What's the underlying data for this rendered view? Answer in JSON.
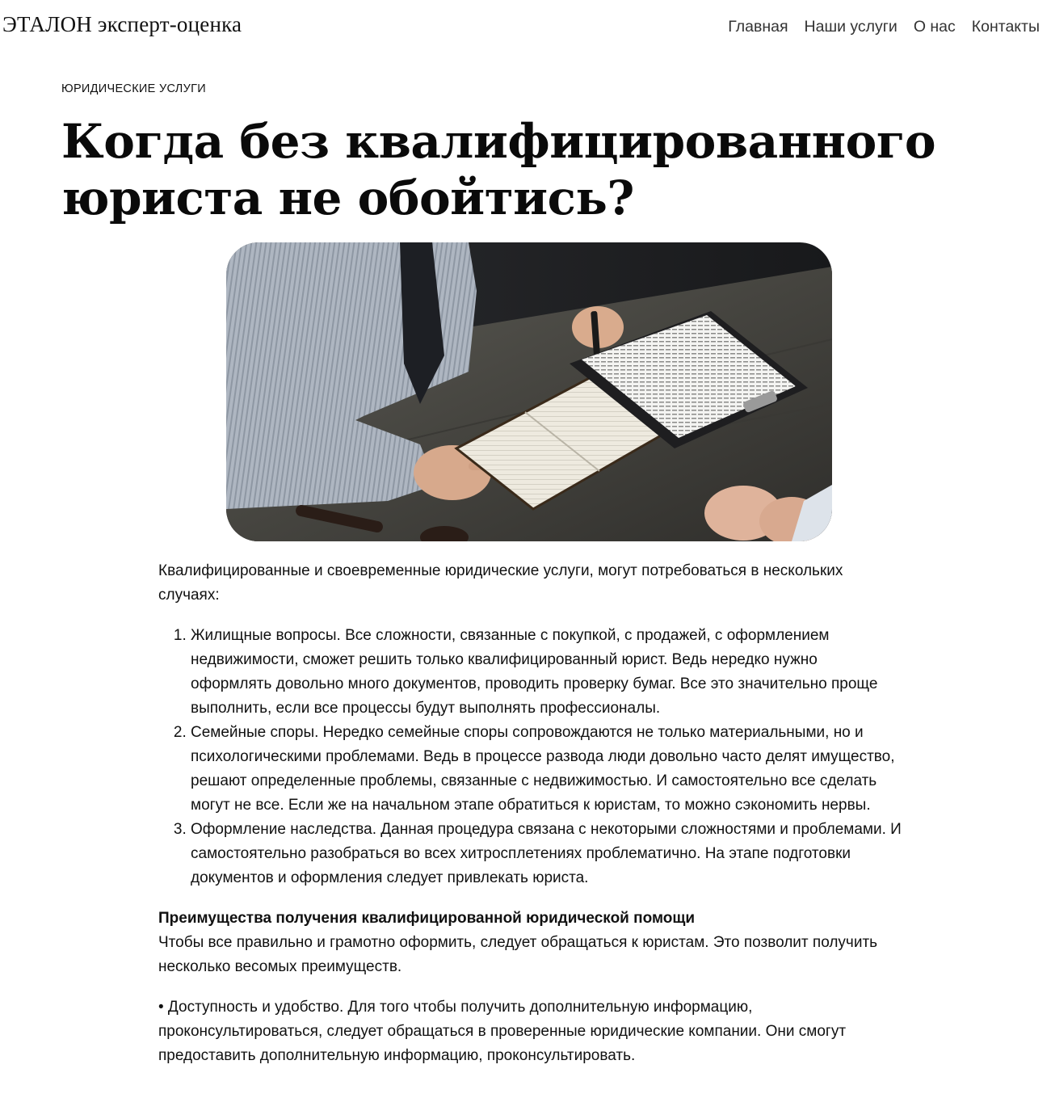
{
  "header": {
    "logo": "ЭТАЛОН эксперт-оценка",
    "nav": [
      "Главная",
      "Наши услуги",
      "О нас",
      "Контакты"
    ]
  },
  "article": {
    "category": "ЮРИДИЧЕСКИЕ УСЛУГИ",
    "title": "Когда без квалифицированного юриста не обойтись?",
    "intro": "Квалифицированные и своевременные юридические услуги, могут потребоваться в нескольких случаях:",
    "list": [
      "Жилищные вопросы. Все сложности, связанные с покупкой, с продажей, с оформлением недвижимости, сможет решить только квалифицированный юрист. Ведь нередко нужно оформлять довольно много документов, проводить проверку бумаг. Все это значительно проще выполнить, если все процессы будут выполнять профессионалы.",
      "Семейные споры. Нередко семейные споры сопровождаются не только материальными, но и психологическими проблемами. Ведь в процессе развода люди довольно часто делят имущество, решают определенные проблемы, связанные с недвижимостью. И самостоятельно все сделать могут не все. Если же на начальном этапе обратиться к юристам, то можно сэкономить нервы.",
      "Оформление наследства. Данная процедура связана с некоторыми сложностями и проблемами. И самостоятельно разобраться во всех хитросплетениях проблематично. На этапе подготовки документов и оформления следует привлекать юриста."
    ],
    "subheading": "Преимущества получения квалифицированной юридической помощи",
    "subheading_text": "Чтобы все правильно и грамотно оформить, следует обращаться к юристам. Это позволит получить несколько весомых преимуществ.",
    "bullet": "• Доступность и удобство. Для того чтобы получить дополнительную информацию, проконсультироваться, следует обращаться в проверенные юридические компании. Они смогут предоставить дополнительную информацию, проконсультировать."
  }
}
